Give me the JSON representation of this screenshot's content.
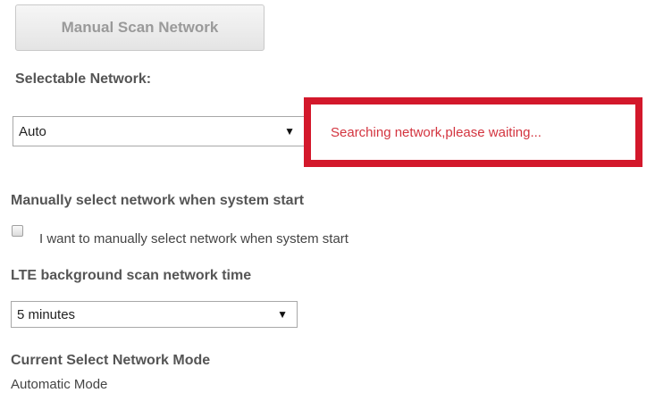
{
  "scan_button": {
    "label": "Manual Scan Network"
  },
  "selectable_network": {
    "heading": "Selectable Network:",
    "selected": "Auto",
    "status": "Searching network,please waiting..."
  },
  "manual_select": {
    "heading": "Manually select network when system start",
    "checkbox_label": "I want to manually select network when system start",
    "checked": false
  },
  "lte_scan": {
    "heading": "LTE background scan network time",
    "selected": "5 minutes"
  },
  "current_mode": {
    "heading": "Current Select Network Mode",
    "value": "Automatic Mode"
  },
  "icons": {
    "dropdown_arrow": "▼"
  },
  "colors": {
    "highlight_border": "#d3182b",
    "status_text": "#d3343f"
  }
}
